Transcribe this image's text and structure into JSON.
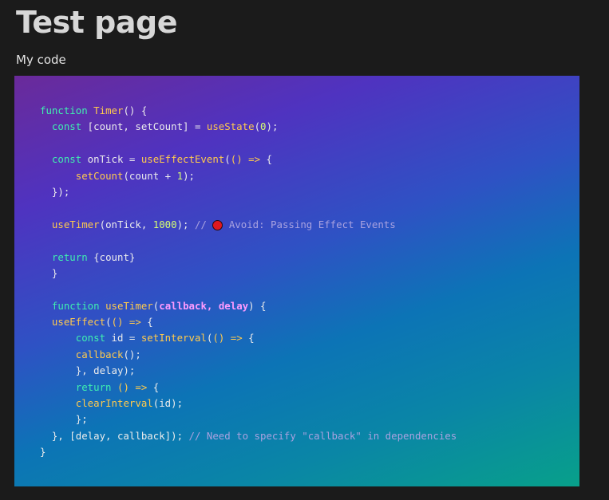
{
  "page": {
    "title": "Test page",
    "subtitle": "My code"
  },
  "code": {
    "lines": [
      [
        {
          "t": "function",
          "c": "kw"
        },
        {
          "t": " ",
          "c": "pl"
        },
        {
          "t": "Timer",
          "c": "fn"
        },
        {
          "t": "() {",
          "c": "pl"
        }
      ],
      [
        {
          "t": "  const",
          "c": "kw"
        },
        {
          "t": " [count, setCount] = ",
          "c": "pl"
        },
        {
          "t": "useState",
          "c": "fn"
        },
        {
          "t": "(",
          "c": "pl"
        },
        {
          "t": "0",
          "c": "num"
        },
        {
          "t": ");",
          "c": "pl"
        }
      ],
      [],
      [
        {
          "t": "  const",
          "c": "kw"
        },
        {
          "t": " onTick = ",
          "c": "pl"
        },
        {
          "t": "useEffectEvent",
          "c": "fn"
        },
        {
          "t": "(",
          "c": "pl"
        },
        {
          "t": "() =>",
          "c": "fn"
        },
        {
          "t": " {",
          "c": "pl"
        }
      ],
      [
        {
          "t": "      ",
          "c": "pl"
        },
        {
          "t": "setCount",
          "c": "fn"
        },
        {
          "t": "(count + ",
          "c": "pl"
        },
        {
          "t": "1",
          "c": "num"
        },
        {
          "t": ");",
          "c": "pl"
        }
      ],
      [
        {
          "t": "  });",
          "c": "pl"
        }
      ],
      [],
      [
        {
          "t": "  ",
          "c": "pl"
        },
        {
          "t": "useTimer",
          "c": "fn"
        },
        {
          "t": "(onTick, ",
          "c": "pl"
        },
        {
          "t": "1000",
          "c": "num"
        },
        {
          "t": "); ",
          "c": "pl"
        },
        {
          "t": "// ",
          "c": "cm"
        },
        {
          "t": "",
          "c": "icon",
          "icon": "stop-icon"
        },
        {
          "t": " Avoid: Passing Effect Events",
          "c": "cm"
        }
      ],
      [],
      [
        {
          "t": "  return",
          "c": "kw"
        },
        {
          "t": " {count}",
          "c": "pl"
        }
      ],
      [
        {
          "t": "  }",
          "c": "pl"
        }
      ],
      [],
      [
        {
          "t": "  function",
          "c": "kw"
        },
        {
          "t": " ",
          "c": "pl"
        },
        {
          "t": "useTimer",
          "c": "fn"
        },
        {
          "t": "(",
          "c": "pl"
        },
        {
          "t": "callback, delay",
          "c": "par"
        },
        {
          "t": ") {",
          "c": "pl"
        }
      ],
      [
        {
          "t": "  ",
          "c": "pl"
        },
        {
          "t": "useEffect",
          "c": "fn"
        },
        {
          "t": "(",
          "c": "pl"
        },
        {
          "t": "() =>",
          "c": "fn"
        },
        {
          "t": " {",
          "c": "pl"
        }
      ],
      [
        {
          "t": "      const",
          "c": "kw"
        },
        {
          "t": " id = ",
          "c": "pl"
        },
        {
          "t": "setInterval",
          "c": "fn"
        },
        {
          "t": "(",
          "c": "pl"
        },
        {
          "t": "() =>",
          "c": "fn"
        },
        {
          "t": " {",
          "c": "pl"
        }
      ],
      [
        {
          "t": "      ",
          "c": "pl"
        },
        {
          "t": "callback",
          "c": "fn"
        },
        {
          "t": "();",
          "c": "pl"
        }
      ],
      [
        {
          "t": "      }, delay);",
          "c": "pl"
        }
      ],
      [
        {
          "t": "      return",
          "c": "kw"
        },
        {
          "t": " ",
          "c": "pl"
        },
        {
          "t": "() =>",
          "c": "fn"
        },
        {
          "t": " {",
          "c": "pl"
        }
      ],
      [
        {
          "t": "      ",
          "c": "pl"
        },
        {
          "t": "clearInterval",
          "c": "fn"
        },
        {
          "t": "(id);",
          "c": "pl"
        }
      ],
      [
        {
          "t": "      };",
          "c": "pl"
        }
      ],
      [
        {
          "t": "  }, [delay, callback]); ",
          "c": "pl"
        },
        {
          "t": "// Need to specify \"callback\" in dependencies",
          "c": "cm"
        }
      ],
      [
        {
          "t": "}",
          "c": "pl"
        }
      ]
    ]
  },
  "colors": {
    "keyword": "#3ff0b0",
    "function": "#ffca4d",
    "number": "#d6ff72",
    "parameter": "#ff9bff",
    "comment": "#a9a2e0",
    "stop_icon": "#e0181f"
  }
}
